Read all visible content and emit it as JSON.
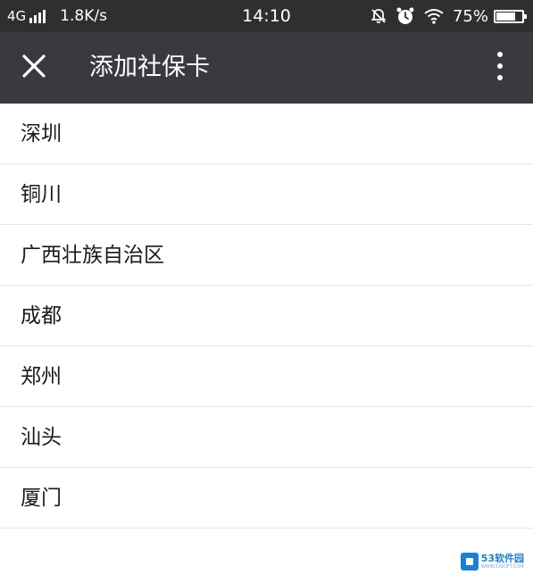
{
  "status_bar": {
    "network": "4G",
    "speed": "1.8K/s",
    "time": "14:10",
    "battery": "75%",
    "battery_level": 0.75,
    "icons": [
      "signal-icon",
      "alarm-muted-icon",
      "alarm-clock-icon",
      "wifi-icon",
      "battery-icon"
    ]
  },
  "app_bar": {
    "title": "添加社保卡",
    "background": "#393a3f",
    "icons": [
      "close-icon",
      "more-vertical-icon"
    ]
  },
  "cities": [
    {
      "label": "深圳"
    },
    {
      "label": "铜川"
    },
    {
      "label": "广西壮族自治区"
    },
    {
      "label": "成都"
    },
    {
      "label": "郑州"
    },
    {
      "label": "汕头"
    },
    {
      "label": "厦门"
    }
  ],
  "watermark": {
    "main": "53软件园",
    "sub": "WWW.53SOFT.COM"
  }
}
